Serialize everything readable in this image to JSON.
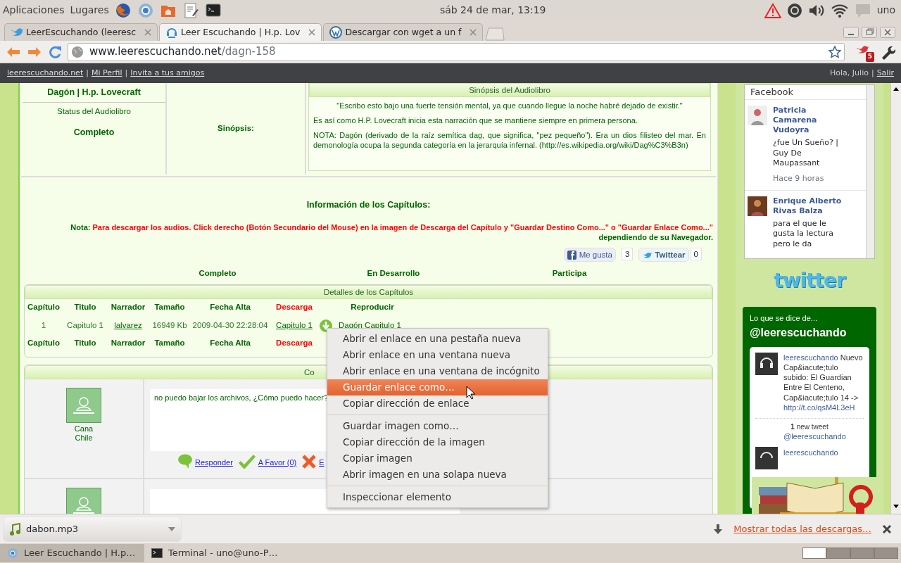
{
  "panel": {
    "menus": [
      "Aplicaciones",
      "Lugares"
    ],
    "clock": "sáb 24 de mar, 13:19",
    "user": "uno"
  },
  "tabs": [
    {
      "title": "LeerEscuchando (leeresc",
      "selected": false,
      "kind": "bird"
    },
    {
      "title": "Leer Escuchando | H.p. Lov",
      "selected": true,
      "kind": "headset"
    },
    {
      "title": "Descargar con wget a un f",
      "selected": false,
      "kind": "wordpress"
    }
  ],
  "address": {
    "host": "www.leerescuchando.net",
    "path": "/dagn-158"
  },
  "extension_badge": "5",
  "site_nav": {
    "links": [
      {
        "kind": "link",
        "text": "leerescuchando.net"
      },
      {
        "kind": "divider",
        "text": "|"
      },
      {
        "kind": "link",
        "text": "Mi Perfil"
      },
      {
        "kind": "divider",
        "text": "|"
      },
      {
        "kind": "link",
        "text": "Invita a tus amigos"
      }
    ],
    "greeting": "Hola, Julio",
    "logout_divider": "|",
    "logout": "Salir"
  },
  "book": {
    "title": "Dagón | H.p. Lovecraft",
    "status_label": "Status del Audiolibro",
    "status": "Completo",
    "synopsis_label": "Sinópsis:",
    "synopsis_heading": "Sinópsis del Audiolibro",
    "paragraphs": [
      {
        "text": "\"Escribo esto bajo una fuerte tensión mental, ya que cuando llegue la noche habré dejado de existir.\"",
        "centered": true
      },
      {
        "text": "Es así como H.P. Lovecraft inicia esta narración que se mantiene siempre en primera persona.",
        "centered": false
      },
      {
        "text": "NOTA: Dagón (derivado de la raíz semítica dag, que significa, \"pez pequeño\"). Era un dios filisteo del mar. En demonología ocupa la segunda categoría en la jerarquía infernal. (http://es.wikipedia.org/wiki/Dag%C3%B3n)",
        "centered": false
      }
    ]
  },
  "chapters_info": {
    "heading": "Información de los Capítulos:",
    "note_label": "Nota:",
    "note": "Para descargar los audios. Click derecho (Botón Secundario del Mouse) en la imagen de Descarga del Capítulo y \"Guardar Destino Como...\" o \"Guardar Enlace Como...\"",
    "note_tail": "dependiendo de su Navegador.",
    "like": {
      "label": "Me gusta",
      "count": "3"
    },
    "tweet": {
      "label": "Twittear",
      "count": "0"
    },
    "statuses": [
      "Completo",
      "En Desarrollo",
      "Participa"
    ]
  },
  "chapters_table": {
    "title": "Detalles de los Capítulos",
    "columns": [
      {
        "label": "Capítulo",
        "color": "#006600"
      },
      {
        "label": "Titulo",
        "color": "#006600"
      },
      {
        "label": "Narrador",
        "color": "#006600"
      },
      {
        "label": "Tamaño",
        "color": "#006600"
      },
      {
        "label": "Fecha Alta",
        "color": "#006600"
      },
      {
        "label": "Descarga",
        "color": "#ff0000"
      },
      {
        "label": "Reproducir",
        "color": "#006600"
      }
    ],
    "rows": [
      {
        "cells": [
          {
            "text": "1",
            "link": false
          },
          {
            "text": "Capitulo 1",
            "link": false
          },
          {
            "text": "lalvarez",
            "link": true
          },
          {
            "text": "16949 Kb",
            "link": false
          },
          {
            "text": "2009-04-30 22:28:04",
            "link": false
          },
          {
            "text": "Capitulo 1",
            "link": true
          },
          {
            "text": "Dagón Capitulo 1",
            "link": true
          }
        ]
      }
    ],
    "footer": [
      {
        "label": "Capítulo",
        "color": "#006600"
      },
      {
        "label": "Titulo",
        "color": "#006600"
      },
      {
        "label": "Narrador",
        "color": "#006600"
      },
      {
        "label": "Tamaño",
        "color": "#006600"
      },
      {
        "label": "Fecha Alta",
        "color": "#006600"
      },
      {
        "label": "Descarga",
        "color": "#ff0000"
      }
    ]
  },
  "comments": {
    "title": "Co",
    "items": [
      {
        "kind": "comment",
        "user": "Cana",
        "country": "Chile",
        "text": "no puedo bajar los archivos, ¿Cómo puedo hacer?",
        "actions": [
          {
            "label": "Responder",
            "kind": "reply"
          },
          {
            "label": "A Favor (0)",
            "kind": "favor"
          },
          {
            "label": "E",
            "kind": "against"
          }
        ]
      },
      {
        "kind": "blank"
      }
    ]
  },
  "context_menu": [
    [
      {
        "label": "Abrir el enlace en una pestaña nueva",
        "selected": false
      },
      {
        "label": "Abrir enlace en una ventana nueva",
        "selected": false
      },
      {
        "label": "Abrir enlace en una ventana de incógnito",
        "selected": false
      },
      {
        "label": "Guardar enlace como…",
        "selected": true
      },
      {
        "label": "Copiar dirección de enlace",
        "selected": false
      }
    ],
    [
      {
        "label": "Guardar imagen como…",
        "selected": false
      },
      {
        "label": "Copiar dirección de la imagen",
        "selected": false
      },
      {
        "label": "Copiar imagen",
        "selected": false
      },
      {
        "label": "Abrir imagen en una solapa nueva",
        "selected": false
      }
    ],
    [
      {
        "label": "Inspeccionar elemento",
        "selected": false
      }
    ]
  ],
  "facebook": {
    "title": "Facebook",
    "posts": [
      {
        "author": "Patricia Camarena Vudoyra",
        "text": "¿fue Un Sueño? | Guy De Maupassant",
        "time": "Hace 9 horas"
      },
      {
        "author": "Enrique Alberto Rivas Balza",
        "text": "para el que le gusta la lectura pero le da"
      }
    ]
  },
  "twitter": {
    "logo": "twitter",
    "intro": "Lo que se dice de...",
    "handle": "@leerescuchando",
    "tweets": [
      {
        "user": "leerescuchando",
        "text": "Nuevo Cap&iacute;tulo subido: El Guardian Entre El Centeno, Cap&iacute;tulo 14 ->",
        "link": "http://t.co/qsM4L3eH"
      }
    ],
    "new_count": "1",
    "new_label": "new tweet",
    "handle_cut": "@leerescuchando",
    "tweet2_user": "leerescuchando"
  },
  "downloads": {
    "file": "dabon.mp3",
    "show_all": "Mostrar todas las descargas…"
  },
  "taskbar": [
    {
      "title": "Leer Escuchando | H.p…",
      "selected": true,
      "kind": "browser"
    },
    {
      "title": "Terminal - uno@uno-P…",
      "selected": false,
      "kind": "terminal"
    }
  ],
  "workspaces": [
    {
      "selected": true
    },
    {
      "selected": false
    },
    {
      "selected": false
    },
    {
      "selected": false
    }
  ]
}
